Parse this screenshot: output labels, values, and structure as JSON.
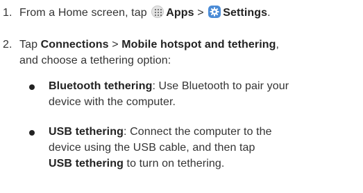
{
  "steps": [
    {
      "number": "1.",
      "pre": "From a Home screen, tap",
      "apps_label": "Apps",
      "sep": ">",
      "settings_label": "Settings",
      "end": "."
    },
    {
      "number": "2.",
      "pre": "Tap",
      "connections": "Connections",
      "sep": ">",
      "hotspot": "Mobile hotspot and tethering",
      "line1_end": ",",
      "line2": "and choose a tethering option:"
    }
  ],
  "options": [
    {
      "title": "Bluetooth tethering",
      "line1_rest": ": Use Bluetooth to pair your",
      "line2": "device with the computer."
    },
    {
      "title": "USB tethering",
      "line1_rest": ": Connect the computer to the",
      "line2": "device using the USB cable, and then tap",
      "line3_bold": "USB tethering",
      "line3_rest": " to turn on tethering."
    }
  ],
  "icons": {
    "apps": "apps-grid-icon",
    "settings": "settings-gear-icon"
  }
}
